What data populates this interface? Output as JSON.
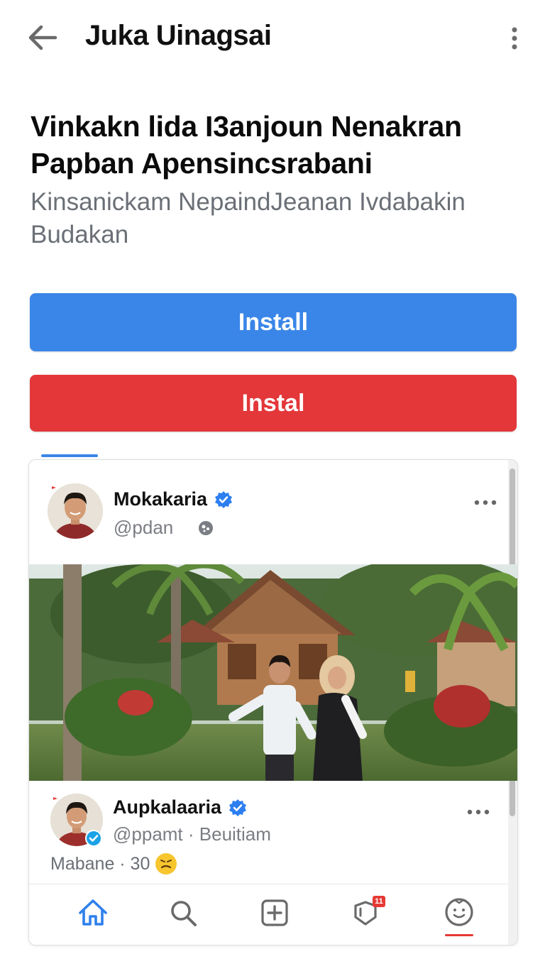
{
  "app_bar": {
    "title": "Juka Uinagsai",
    "back_icon": "arrow-left-icon",
    "menu_icon": "more-vertical-icon"
  },
  "page": {
    "headline": "Vinkakn lida I3anjoun Nenakran Papban Apensincsrabani",
    "subheadline": "Kinsanickam NepaindJeanan Ivdabakin Budakan"
  },
  "buttons": {
    "install_primary": "Install",
    "install_secondary": "Instal"
  },
  "post": {
    "author_name": "Mokakaria",
    "handle": "@pdan",
    "verified_icon": "verified-badge-icon",
    "more_icon": "more-horizontal-icon"
  },
  "reply": {
    "author_name": "Aupkalaaria",
    "handle": "@ppamt · Beuitiam",
    "meta": "Mabane · 30",
    "emoji": "grimace-emoji-icon"
  },
  "bottom_nav": {
    "items": [
      "home-icon",
      "search-icon",
      "add-post-icon",
      "notifications-icon",
      "profile-icon"
    ],
    "badge": "11"
  },
  "colors": {
    "primary_blue": "#3a86e8",
    "danger_red": "#e3373a",
    "verified_blue": "#2d7ff0"
  }
}
